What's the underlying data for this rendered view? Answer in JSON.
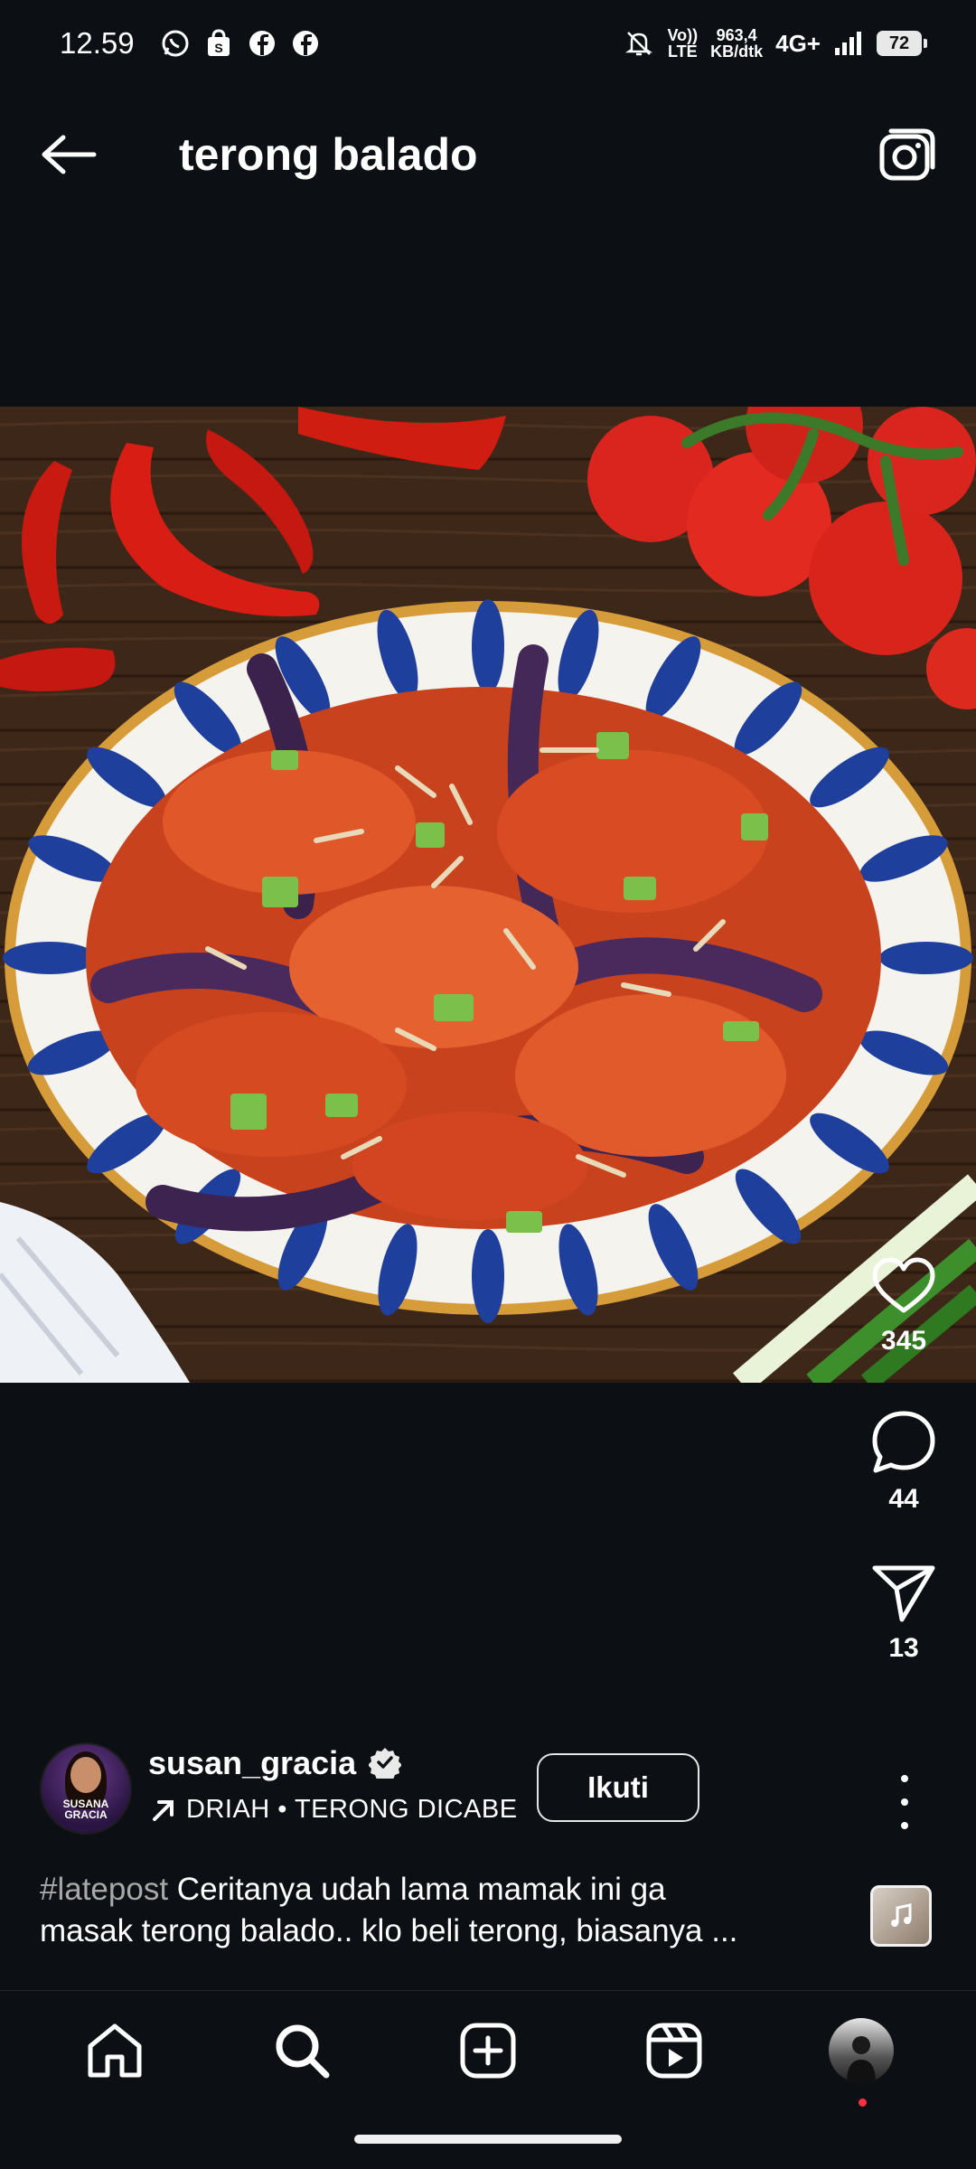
{
  "status_bar": {
    "time": "12.59",
    "speed_value": "963,4",
    "speed_unit": "KB/dtk",
    "network": "4G+",
    "volte_line1": "Vo))",
    "volte_line2": "LTE",
    "battery": "72",
    "notification_icons": [
      "whatsapp-icon",
      "shopee-icon",
      "facebook-icon",
      "facebook-icon"
    ]
  },
  "header": {
    "title": "terong balado"
  },
  "post": {
    "likes": "345",
    "comments": "44",
    "shares": "13",
    "author": {
      "username": "susan_gracia",
      "avatar_text": "SUSANA GRACIA",
      "audio": "DRIAH • TERONG DICABE",
      "follow_label": "Ikuti"
    },
    "caption": {
      "hashtag": "#latepost",
      "text_line1": " Ceritanya udah lama mamak ini ga",
      "text_line2": "masak terong balado.. klo beli terong, biasanya ..."
    }
  },
  "nav": {
    "items": [
      "home-icon",
      "search-icon",
      "create-icon",
      "reels-icon",
      "profile-avatar"
    ]
  },
  "colors": {
    "background": "#0c1014",
    "accent_dot": "#ff3040"
  }
}
